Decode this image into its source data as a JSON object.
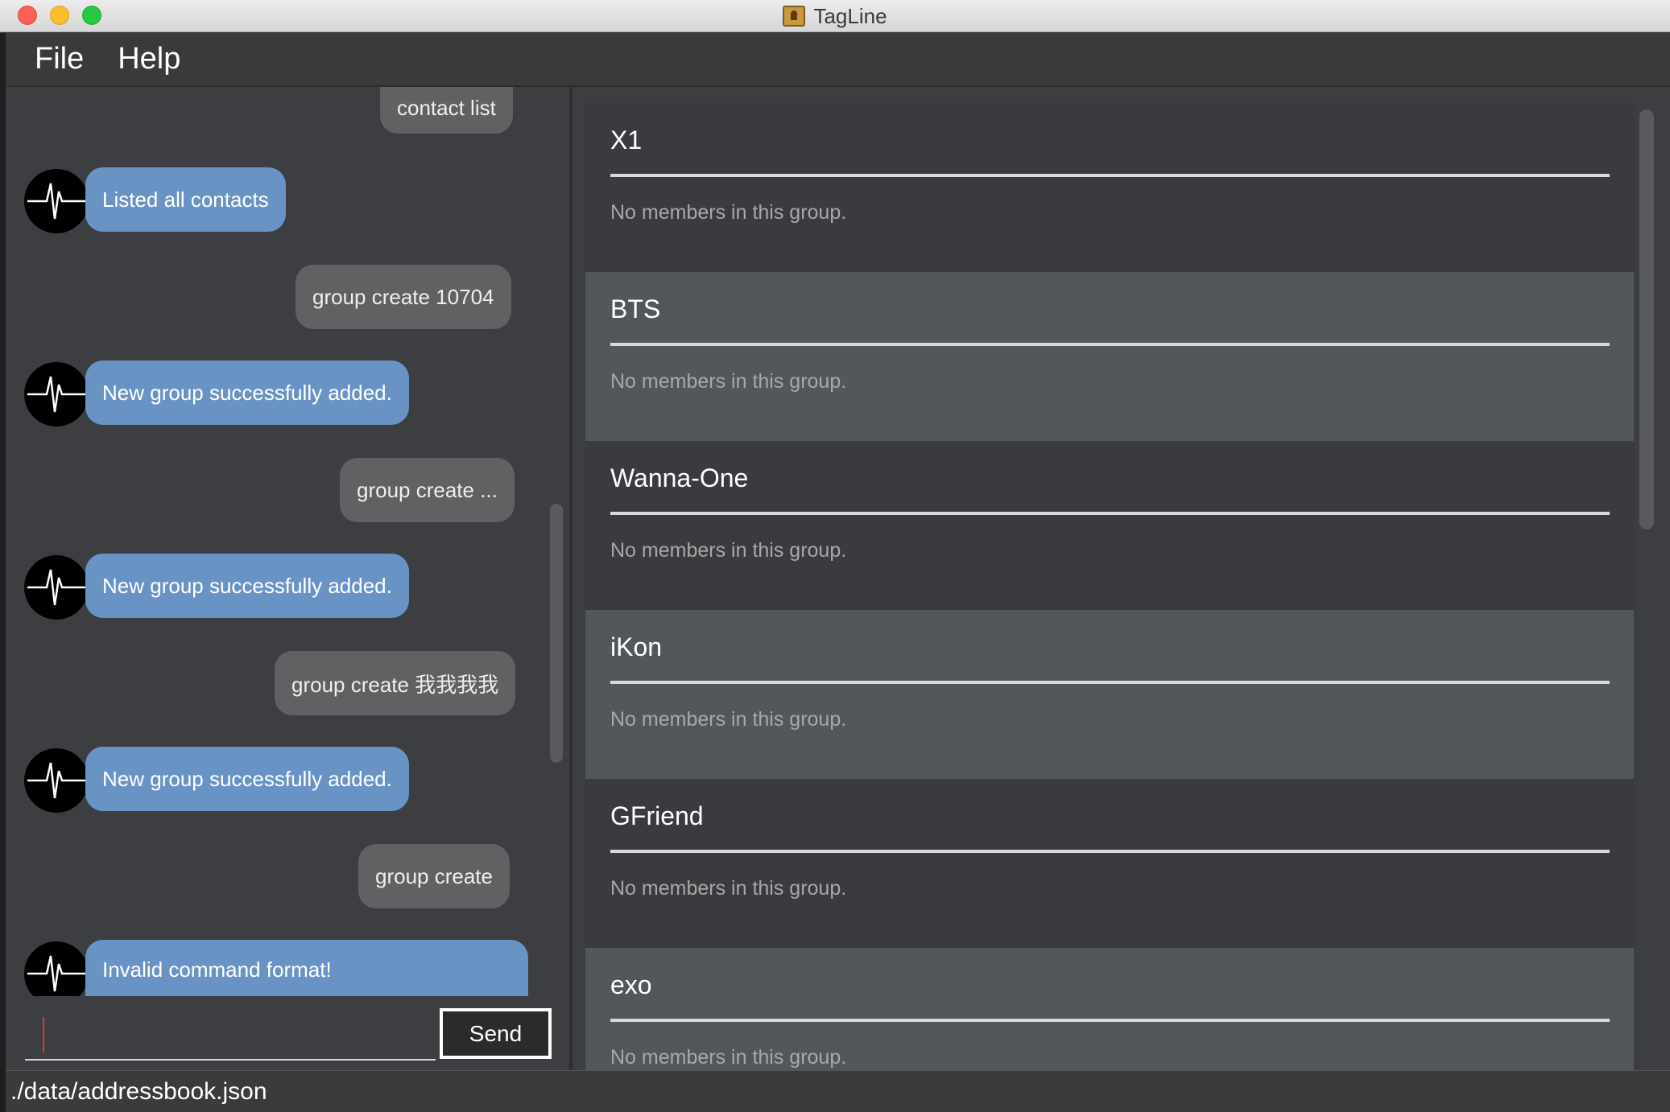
{
  "window": {
    "title": "TagLine"
  },
  "menu": {
    "file": "File",
    "help": "Help"
  },
  "chat": {
    "messages": [
      {
        "role": "user",
        "text": "contact list"
      },
      {
        "role": "bot",
        "text": "Listed all contacts"
      },
      {
        "role": "user",
        "text": "group create 10704"
      },
      {
        "role": "bot",
        "text": "New group successfully added."
      },
      {
        "role": "user",
        "text": "group create ..."
      },
      {
        "role": "bot",
        "text": "New group successfully added."
      },
      {
        "role": "user",
        "text": "group create 我我我我"
      },
      {
        "role": "bot",
        "text": "New group successfully added."
      },
      {
        "role": "user",
        "text": "group create"
      },
      {
        "role": "bot",
        "text": "Invalid command format!"
      }
    ],
    "input_value": "",
    "send_label": "Send"
  },
  "groups": [
    {
      "name": "X1",
      "members_text": "No members in this group."
    },
    {
      "name": "BTS",
      "members_text": "No members in this group."
    },
    {
      "name": "Wanna-One",
      "members_text": "No members in this group."
    },
    {
      "name": "iKon",
      "members_text": "No members in this group."
    },
    {
      "name": "GFriend",
      "members_text": "No members in this group."
    },
    {
      "name": "exo",
      "members_text": "No members in this group."
    }
  ],
  "status": {
    "file_path": "./data/addressbook.json"
  },
  "colors": {
    "bot_bubble": "#6a93c5",
    "user_bubble": "#5f6163",
    "background": "#3c3e41"
  }
}
